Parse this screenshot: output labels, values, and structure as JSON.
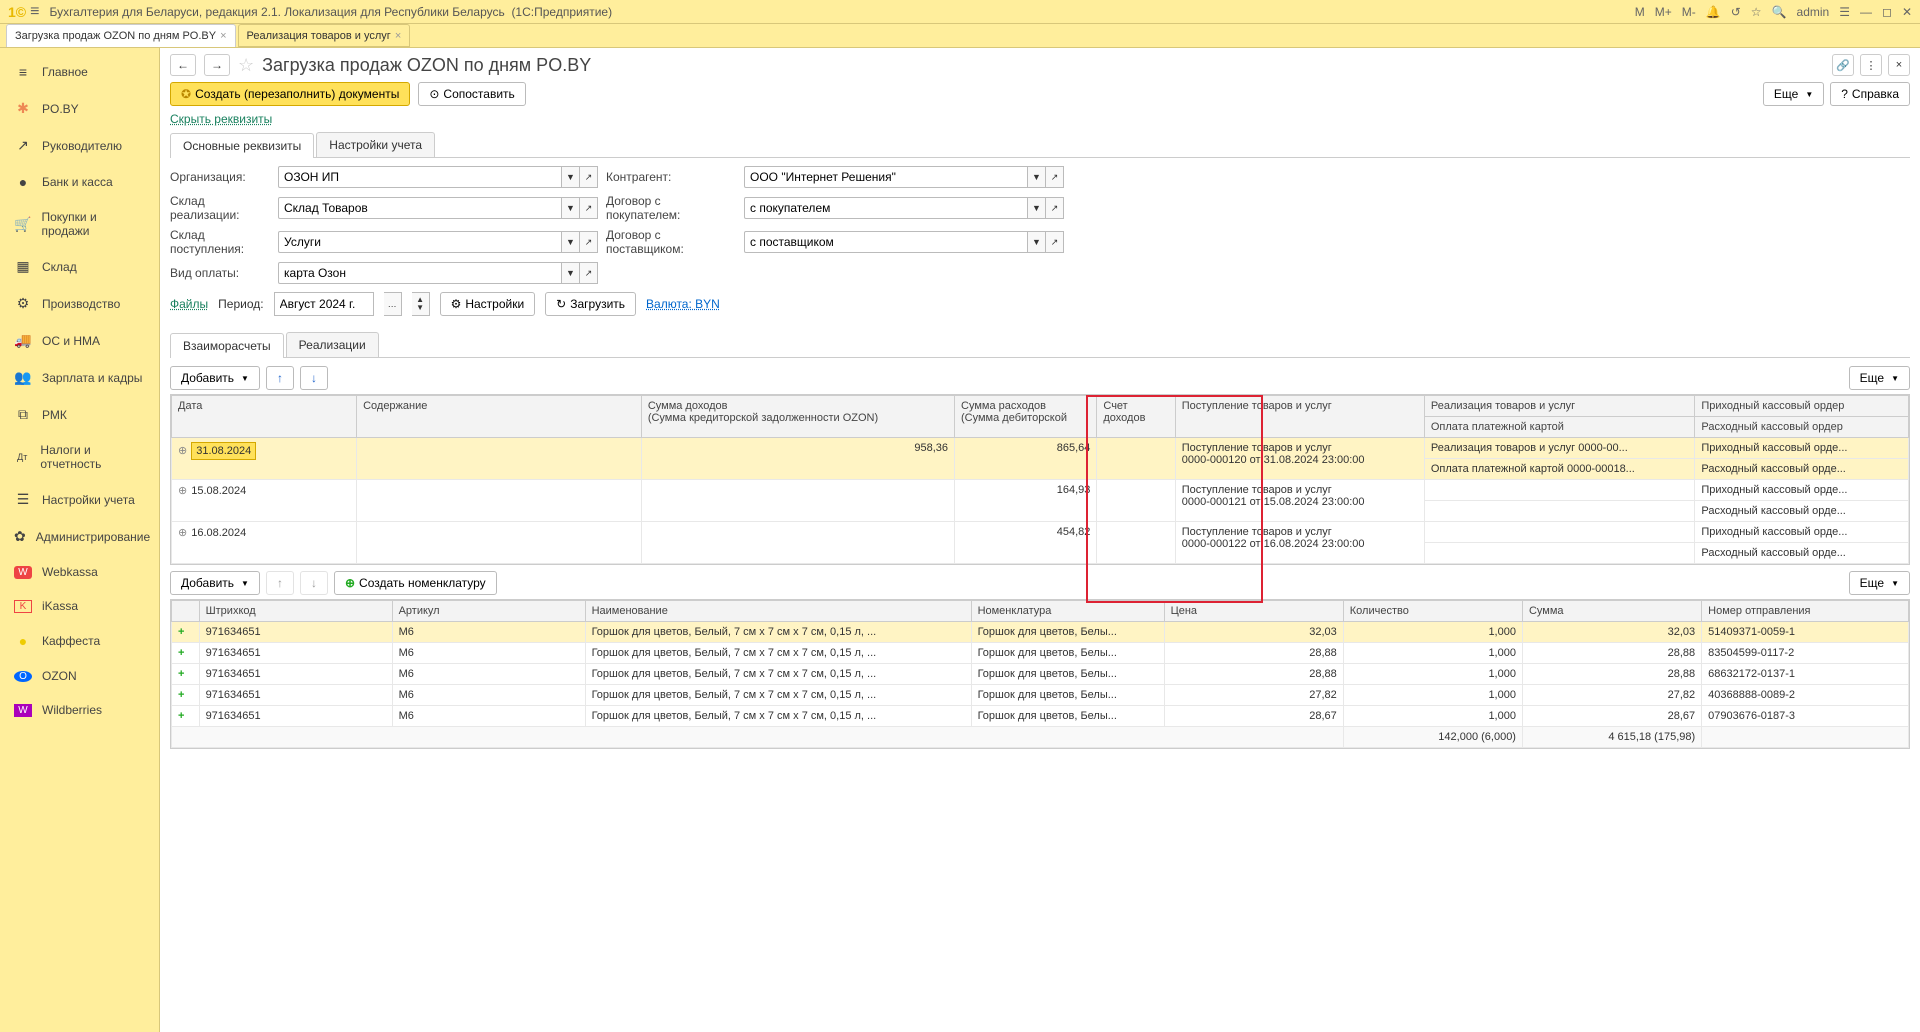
{
  "titlebar": {
    "app": "Бухгалтерия для Беларуси, редакция 2.1. Локализация для Республики Беларусь",
    "platform": "(1С:Предприятие)",
    "user": "admin",
    "m": "M",
    "mplus": "M+",
    "mminus": "M-"
  },
  "tabs": [
    {
      "label": "Загрузка продаж OZON по дням PO.BY",
      "active": true
    },
    {
      "label": "Реализация товаров и услуг",
      "active": false
    }
  ],
  "sidebar": [
    {
      "icon": "≡",
      "label": "Главное"
    },
    {
      "icon": "✱",
      "label": "PO.BY"
    },
    {
      "icon": "↗",
      "label": "Руководителю"
    },
    {
      "icon": "●",
      "label": "Банк и касса"
    },
    {
      "icon": "🛒",
      "label": "Покупки и продажи"
    },
    {
      "icon": "▦",
      "label": "Склад"
    },
    {
      "icon": "⚙",
      "label": "Производство"
    },
    {
      "icon": "🚚",
      "label": "ОС и НМА"
    },
    {
      "icon": "👥",
      "label": "Зарплата и кадры"
    },
    {
      "icon": "⧉",
      "label": "РМК"
    },
    {
      "icon": "Дт",
      "label": "Налоги и отчетность"
    },
    {
      "icon": "☰",
      "label": "Настройки учета"
    },
    {
      "icon": "✿",
      "label": "Администрирование"
    },
    {
      "icon": "W",
      "label": "Webkassa"
    },
    {
      "icon": "K",
      "label": "iKassa"
    },
    {
      "icon": "●",
      "label": "Каффеста"
    },
    {
      "icon": "O",
      "label": "OZON"
    },
    {
      "icon": "W",
      "label": "Wildberries"
    }
  ],
  "page": {
    "title": "Загрузка продаж OZON по дням PO.BY",
    "btn_create": "Создать (перезаполнить) документы",
    "btn_compare": "Сопоставить",
    "hide_req": "Скрыть реквизиты",
    "more": "Еще",
    "help": "Справка"
  },
  "form_tabs": [
    "Основные реквизиты",
    "Настройки учета"
  ],
  "form": {
    "org_label": "Организация:",
    "org_val": "ОЗОН ИП",
    "counter_label": "Контрагент:",
    "counter_val": "ООО \"Интернет Решения\"",
    "wh_sale_label": "Склад реализации:",
    "wh_sale_val": "Склад Товаров",
    "contract_buyer_label": "Договор с покупателем:",
    "contract_buyer_val": "с покупателем",
    "wh_in_label": "Склад поступления:",
    "wh_in_val": "Услуги",
    "contract_supplier_label": "Договор с поставщиком:",
    "contract_supplier_val": "с поставщиком",
    "payment_label": "Вид оплаты:",
    "payment_val": "карта Озон"
  },
  "files": "Файлы",
  "period_label": "Период:",
  "period_val": "Август 2024 г.",
  "btn_settings": "Настройки",
  "btn_load": "Загрузить",
  "currency": "Валюта: BYN",
  "grid_tabs": [
    "Взаиморасчеты",
    "Реализации"
  ],
  "btn_add": "Добавить",
  "grid1": {
    "headers": {
      "date": "Дата",
      "content": "Содержание",
      "income": "Сумма доходов",
      "income2": "(Сумма кредиторской задолженности OZON)",
      "expense": "Сумма расходов",
      "expense2": "(Сумма дебиторской",
      "account": "Счет доходов",
      "receipt": "Поступление товаров и услуг",
      "realize": "Реализация товаров и услуг",
      "card_pay": "Оплата платежной картой",
      "cash_in": "Приходный кассовый ордер",
      "cash_out": "Расходный кассовый ордер"
    },
    "rows": [
      {
        "date": "31.08.2024",
        "income": "958,36",
        "expense": "865,64",
        "receipt1": "Поступление товаров и услуг",
        "receipt2": "0000-000120 от 31.08.2024 23:00:00",
        "realize": "Реализация товаров и услуг 0000-00...",
        "card_pay": "Оплата платежной картой 0000-00018...",
        "cash_in": "Приходный кассовый орде...",
        "cash_out": "Расходный кассовый орде...",
        "selected": true
      },
      {
        "date": "15.08.2024",
        "income": "",
        "expense": "164,93",
        "receipt1": "Поступление товаров и услуг",
        "receipt2": "0000-000121 от 15.08.2024 23:00:00",
        "realize": "",
        "card_pay": "",
        "cash_in": "Приходный кассовый орде...",
        "cash_out": "Расходный кассовый орде..."
      },
      {
        "date": "16.08.2024",
        "income": "",
        "expense": "454,82",
        "receipt1": "Поступление товаров и услуг",
        "receipt2": "0000-000122 от 16.08.2024 23:00:00",
        "realize": "",
        "card_pay": "",
        "cash_in": "Приходный кассовый орде...",
        "cash_out": "Расходный кассовый орде..."
      }
    ]
  },
  "btn_create_nom": "Создать номенклатуру",
  "grid2": {
    "headers": {
      "barcode": "Штрихкод",
      "article": "Артикул",
      "name": "Наименование",
      "nom": "Номенклатура",
      "price": "Цена",
      "qty": "Количество",
      "sum": "Сумма",
      "shipment": "Номер отправления"
    },
    "rows": [
      {
        "barcode": "971634651",
        "article": "M6",
        "name": "Горшок для цветов, Белый, 7 см x 7 см x 7 см, 0,15 л, ...",
        "nom": "Горшок для цветов, Белы...",
        "price": "32,03",
        "qty": "1,000",
        "sum": "32,03",
        "ship": "51409371-0059-1",
        "sel": true
      },
      {
        "barcode": "971634651",
        "article": "M6",
        "name": "Горшок для цветов, Белый, 7 см x 7 см x 7 см, 0,15 л, ...",
        "nom": "Горшок для цветов, Белы...",
        "price": "28,88",
        "qty": "1,000",
        "sum": "28,88",
        "ship": "83504599-0117-2"
      },
      {
        "barcode": "971634651",
        "article": "M6",
        "name": "Горшок для цветов, Белый, 7 см x 7 см x 7 см, 0,15 л, ...",
        "nom": "Горшок для цветов, Белы...",
        "price": "28,88",
        "qty": "1,000",
        "sum": "28,88",
        "ship": "68632172-0137-1"
      },
      {
        "barcode": "971634651",
        "article": "M6",
        "name": "Горшок для цветов, Белый, 7 см x 7 см x 7 см, 0,15 л, ...",
        "nom": "Горшок для цветов, Белы...",
        "price": "27,82",
        "qty": "1,000",
        "sum": "27,82",
        "ship": "40368888-0089-2"
      },
      {
        "barcode": "971634651",
        "article": "M6",
        "name": "Горшок для цветов, Белый, 7 см x 7 см x 7 см, 0,15 л, ...",
        "nom": "Горшок для цветов, Белы...",
        "price": "28,67",
        "qty": "1,000",
        "sum": "28,67",
        "ship": "07903676-0187-3"
      }
    ],
    "footer": {
      "qty": "142,000 (6,000)",
      "sum": "4 615,18 (175,98)"
    }
  }
}
